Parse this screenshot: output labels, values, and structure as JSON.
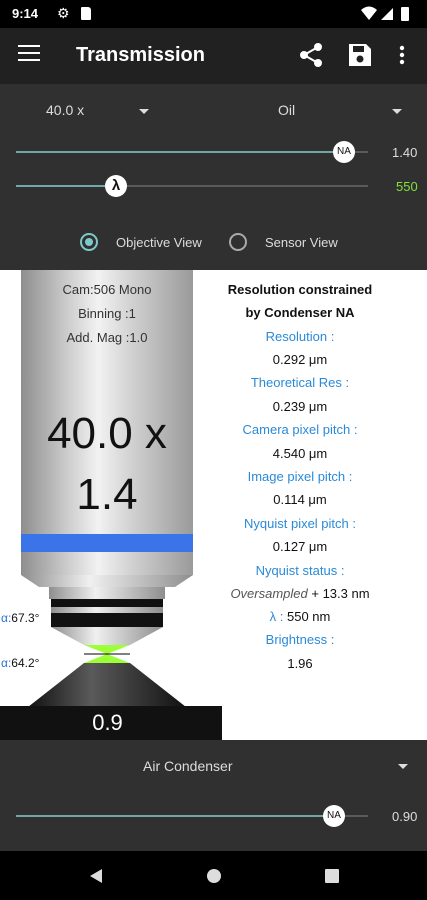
{
  "status_bar": {
    "time": "9:14"
  },
  "app_bar": {
    "title": "Transmission"
  },
  "controls": {
    "magnification": "40.0 x",
    "immersion": "Oil",
    "na_slider": {
      "thumb_label": "NA",
      "value": "1.40",
      "fraction": 0.95
    },
    "wavelength_slider": {
      "thumb_label": "λ",
      "value": "550",
      "fraction": 0.28
    },
    "views": [
      {
        "label": "Objective View",
        "selected": true
      },
      {
        "label": "Sensor View",
        "selected": false
      }
    ]
  },
  "objective": {
    "camera": "Cam:506 Mono",
    "binning": "Binning :1",
    "add_mag": "Add. Mag :1.0",
    "mag_big": "40.0 x",
    "na_big": "1.4",
    "angle_top": {
      "symbol": "α:",
      "value": "67.3°"
    },
    "angle_bottom": {
      "symbol": "α:",
      "value": "64.2°"
    },
    "condenser_na": "0.9"
  },
  "info": {
    "heading1": "Resolution constrained",
    "heading2": "by Condenser NA",
    "resolution_label": "Resolution :",
    "resolution_value": "0.292 μm",
    "theoretical_label": "Theoretical Res :",
    "theoretical_value": "0.239 μm",
    "camera_pitch_label": "Camera pixel pitch :",
    "camera_pitch_value": "4.540 μm",
    "image_pitch_label": "Image pixel pitch :",
    "image_pitch_value": "0.114 μm",
    "nyquist_pitch_label": "Nyquist pixel pitch :",
    "nyquist_pitch_value": "0.127 μm",
    "nyquist_status_label": "Nyquist status :",
    "nyquist_status_word": "Oversampled",
    "nyquist_status_value": "+  13.3 nm",
    "lambda_label": "λ :",
    "lambda_value": "550 nm",
    "brightness_label": "Brightness :",
    "brightness_value": "1.96"
  },
  "condenser": {
    "type": "Air Condenser",
    "na_slider": {
      "thumb_label": "NA",
      "value": "0.90",
      "fraction": 0.91
    }
  },
  "colors": {
    "accent": "#7ec8c8",
    "wavelength": "#7ee23a",
    "label_blue": "#2a8ad8",
    "band_blue": "#3b74e8"
  }
}
